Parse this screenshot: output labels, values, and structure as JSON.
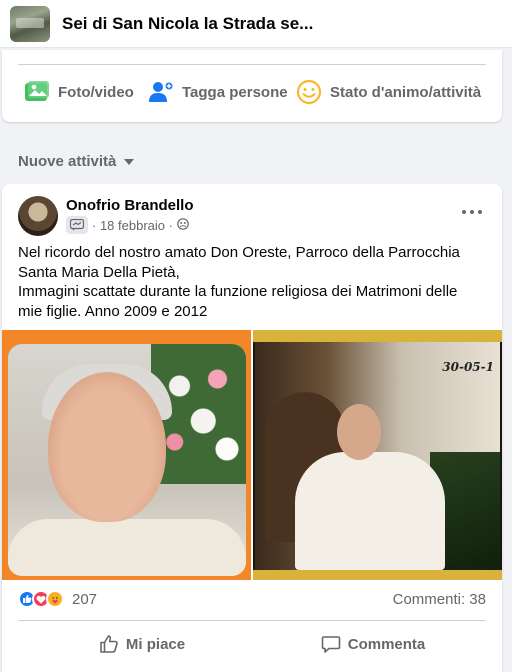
{
  "header": {
    "title": "Sei di San Nicola la Strada se..."
  },
  "composer": {
    "photo_label": "Foto/video",
    "tag_label": "Tagga persone",
    "feeling_label": "Stato d'animo/attività"
  },
  "feed": {
    "sort_label": "Nuove attività"
  },
  "post": {
    "author": "Onofrio Brandello",
    "date": "18 febbraio",
    "text_lines": [
      "Nel ricordo del nostro amato Don Oreste,  Parroco della Parrocchia",
      "Santa Maria Della Pietà,",
      "Immagini scattate durante la funzione religiosa dei Matrimoni delle",
      "mie figlie. Anno 2009 e 2012"
    ],
    "photo_date_stamp": "30-05-1",
    "reactions_count": "207",
    "comments_label": "Commenti: 38",
    "like_label": "Mi piace",
    "comment_label": "Commenta"
  },
  "colors": {
    "accent": "#1877f2",
    "love": "#f33e58",
    "care": "#f7b125",
    "photo_green": "#45bd62",
    "feeling_yellow": "#f7b928"
  },
  "icons": [
    "group-thumbnail",
    "photo-icon",
    "tag-people-icon",
    "feeling-icon",
    "chevron-down-icon",
    "messenger-badge-icon",
    "privacy-group-icon",
    "more-icon",
    "like-reaction-icon",
    "love-reaction-icon",
    "care-reaction-icon",
    "thumbs-up-icon",
    "comment-icon"
  ]
}
